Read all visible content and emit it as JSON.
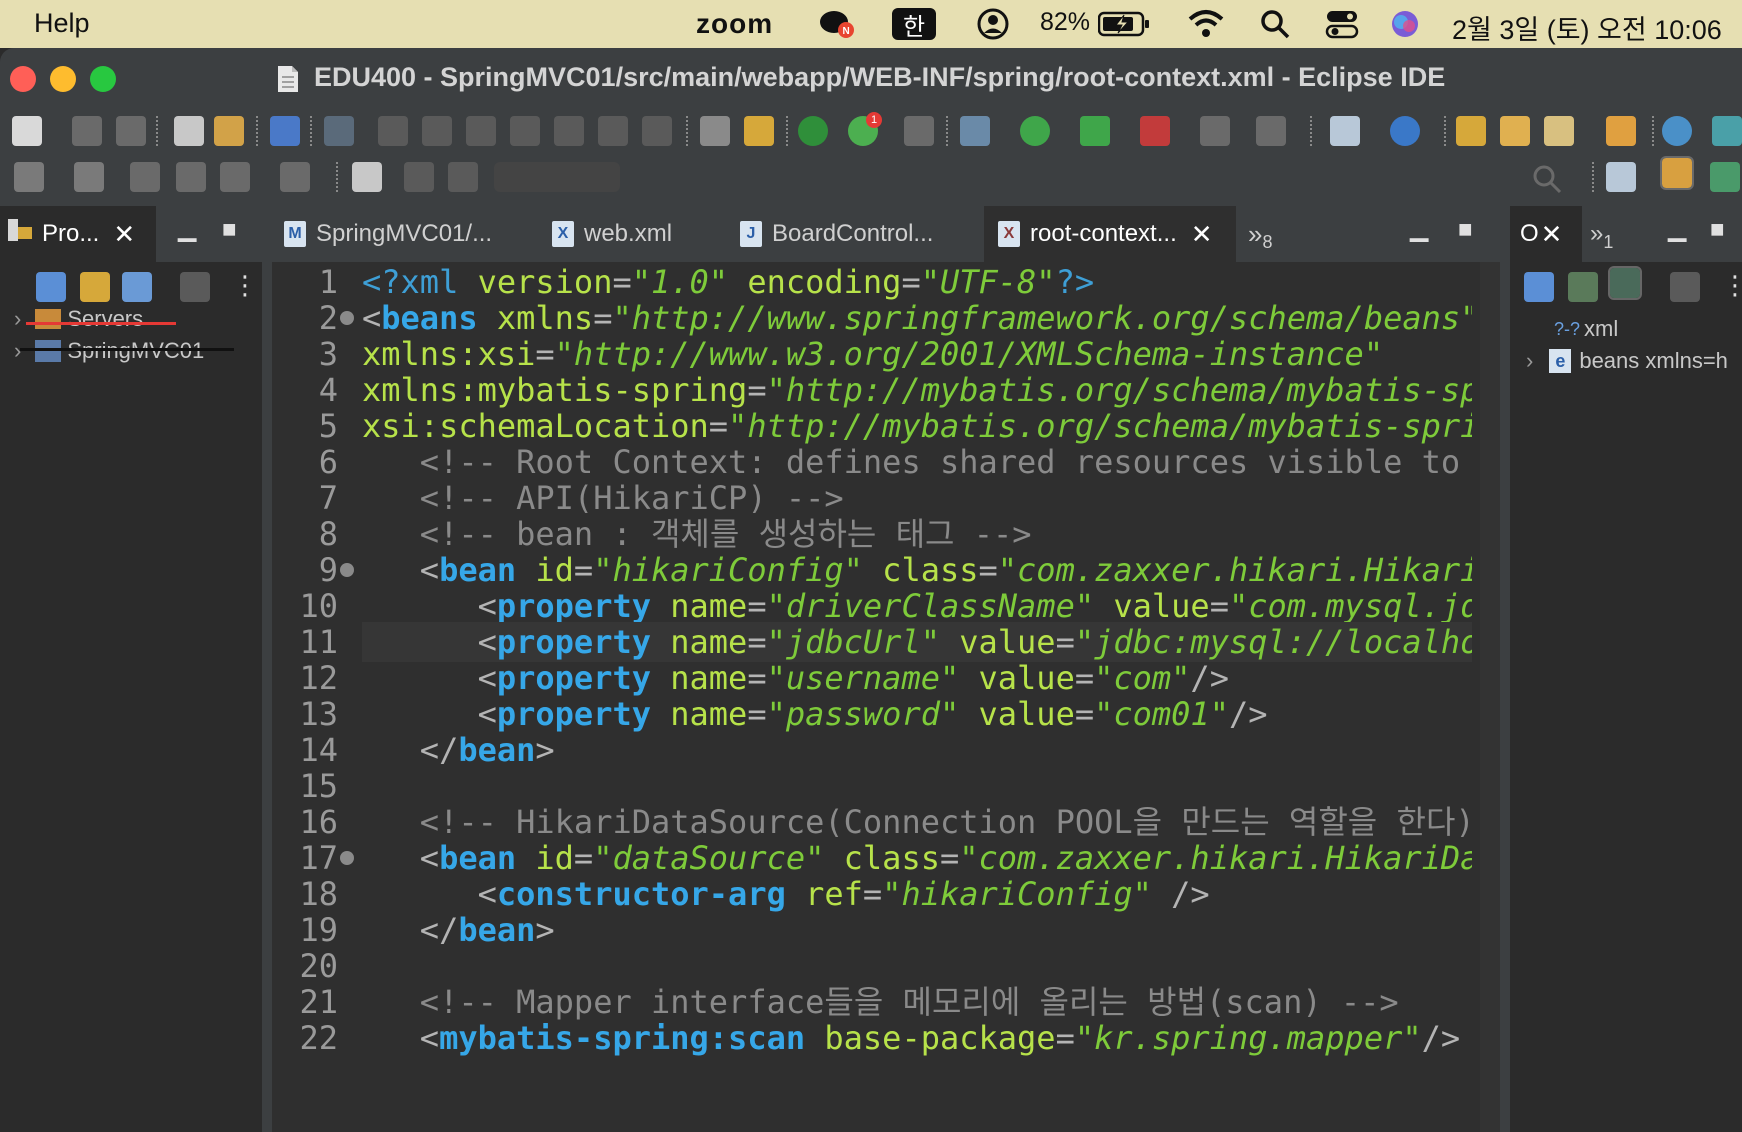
{
  "menubar": {
    "help": "Help",
    "zoom": "zoom",
    "input_method": "한",
    "battery": "82%",
    "datetime": "2월 3일 (토) 오전 10:06",
    "icons": [
      "chat-icon",
      "user-icon",
      "battery-icon",
      "wifi-icon",
      "search-icon",
      "control-center-icon",
      "siri-icon"
    ]
  },
  "window": {
    "title": "EDU400 - SpringMVC01/src/main/webapp/WEB-INF/spring/root-context.xml - Eclipse IDE",
    "colors": {
      "close": "#ff5f57",
      "minimize": "#febc2e",
      "zoom": "#28c840"
    }
  },
  "package_explorer": {
    "tab_label": "Pro...",
    "items": [
      {
        "label": "Servers"
      },
      {
        "label": "SpringMVC01"
      }
    ]
  },
  "editor": {
    "tabs": [
      {
        "label": "SpringMVC01/...",
        "icon": "M"
      },
      {
        "label": "web.xml",
        "icon": "X"
      },
      {
        "label": "BoardControl...",
        "icon": "J"
      },
      {
        "label": "root-context...",
        "icon": "X",
        "active": true
      }
    ],
    "overflow": "»",
    "overflow_count": "8",
    "current_line": 11,
    "lines": [
      {
        "n": "1",
        "fold": false,
        "tokens": [
          [
            "pi",
            "<?xml "
          ],
          [
            "attr",
            "version"
          ],
          [
            "punct",
            "="
          ],
          [
            "val",
            "\"1.0\""
          ],
          [
            "plain",
            " "
          ],
          [
            "attr",
            "encoding"
          ],
          [
            "punct",
            "="
          ],
          [
            "val",
            "\"UTF-8\""
          ],
          [
            "pi",
            "?>"
          ]
        ]
      },
      {
        "n": "2",
        "fold": true,
        "tokens": [
          [
            "punct",
            "<"
          ],
          [
            "tag",
            "beans"
          ],
          [
            "plain",
            " "
          ],
          [
            "attr",
            "xmlns"
          ],
          [
            "punct",
            "="
          ],
          [
            "val",
            "\"http://www.springframework.org/schema/beans\""
          ]
        ]
      },
      {
        "n": "3",
        "fold": false,
        "tokens": [
          [
            "attr",
            "xmlns:xsi"
          ],
          [
            "punct",
            "="
          ],
          [
            "val",
            "\"http://www.w3.org/2001/XMLSchema-instance\""
          ]
        ]
      },
      {
        "n": "4",
        "fold": false,
        "tokens": [
          [
            "attr",
            "xmlns:mybatis-spring"
          ],
          [
            "punct",
            "="
          ],
          [
            "val",
            "\"http://mybatis.org/schema/mybatis-spring\""
          ]
        ]
      },
      {
        "n": "5",
        "fold": false,
        "tokens": [
          [
            "attr",
            "xsi:schemaLocation"
          ],
          [
            "punct",
            "="
          ],
          [
            "val",
            "\"http://mybatis.org/schema/mybatis-spring"
          ]
        ]
      },
      {
        "n": "6",
        "fold": false,
        "tokens": [
          [
            "plain",
            "   "
          ],
          [
            "com",
            "<!-- Root Context: defines shared resources visible to"
          ]
        ]
      },
      {
        "n": "7",
        "fold": false,
        "tokens": [
          [
            "plain",
            "   "
          ],
          [
            "com",
            "<!-- API(HikariCP) -->"
          ]
        ]
      },
      {
        "n": "8",
        "fold": false,
        "tokens": [
          [
            "plain",
            "   "
          ],
          [
            "com",
            "<!-- bean : 객체를 생성하는 태그 -->"
          ]
        ]
      },
      {
        "n": "9",
        "fold": true,
        "tokens": [
          [
            "plain",
            "   "
          ],
          [
            "punct",
            "<"
          ],
          [
            "tag",
            "bean"
          ],
          [
            "plain",
            " "
          ],
          [
            "attr",
            "id"
          ],
          [
            "punct",
            "="
          ],
          [
            "val",
            "\"hikariConfig\""
          ],
          [
            "plain",
            " "
          ],
          [
            "attr",
            "class"
          ],
          [
            "punct",
            "="
          ],
          [
            "val",
            "\"com.zaxxer.hikari.HikariConfig\""
          ]
        ]
      },
      {
        "n": "10",
        "fold": false,
        "tokens": [
          [
            "plain",
            "      "
          ],
          [
            "punct",
            "<"
          ],
          [
            "tag",
            "property"
          ],
          [
            "plain",
            " "
          ],
          [
            "attr",
            "name"
          ],
          [
            "punct",
            "="
          ],
          [
            "val",
            "\"driverClassName\""
          ],
          [
            "plain",
            " "
          ],
          [
            "attr",
            "value"
          ],
          [
            "punct",
            "="
          ],
          [
            "val",
            "\"com.mysql.jdbc"
          ]
        ]
      },
      {
        "n": "11",
        "fold": false,
        "tokens": [
          [
            "plain",
            "      "
          ],
          [
            "punct",
            "<"
          ],
          [
            "tag",
            "property"
          ],
          [
            "plain",
            " "
          ],
          [
            "attr",
            "name"
          ],
          [
            "punct",
            "="
          ],
          [
            "val",
            "\"jdbcUrl\""
          ],
          [
            "plain",
            " "
          ],
          [
            "attr",
            "value"
          ],
          [
            "punct",
            "="
          ],
          [
            "val",
            "\"jdbc:mysql://localhost"
          ]
        ]
      },
      {
        "n": "12",
        "fold": false,
        "tokens": [
          [
            "plain",
            "      "
          ],
          [
            "punct",
            "<"
          ],
          [
            "tag",
            "property"
          ],
          [
            "plain",
            " "
          ],
          [
            "attr",
            "name"
          ],
          [
            "punct",
            "="
          ],
          [
            "val",
            "\"username\""
          ],
          [
            "plain",
            " "
          ],
          [
            "attr",
            "value"
          ],
          [
            "punct",
            "="
          ],
          [
            "val",
            "\"com\""
          ],
          [
            "punct",
            "/>"
          ]
        ]
      },
      {
        "n": "13",
        "fold": false,
        "tokens": [
          [
            "plain",
            "      "
          ],
          [
            "punct",
            "<"
          ],
          [
            "tag",
            "property"
          ],
          [
            "plain",
            " "
          ],
          [
            "attr",
            "name"
          ],
          [
            "punct",
            "="
          ],
          [
            "val",
            "\"password\""
          ],
          [
            "plain",
            " "
          ],
          [
            "attr",
            "value"
          ],
          [
            "punct",
            "="
          ],
          [
            "val",
            "\"com01\""
          ],
          [
            "punct",
            "/>"
          ]
        ]
      },
      {
        "n": "14",
        "fold": false,
        "tokens": [
          [
            "plain",
            "   "
          ],
          [
            "punct",
            "</"
          ],
          [
            "tag",
            "bean"
          ],
          [
            "punct",
            ">"
          ]
        ]
      },
      {
        "n": "15",
        "fold": false,
        "tokens": []
      },
      {
        "n": "16",
        "fold": false,
        "tokens": [
          [
            "plain",
            "   "
          ],
          [
            "com",
            "<!-- HikariDataSource(Connection POOL을 만드는 역할을 한다)"
          ]
        ]
      },
      {
        "n": "17",
        "fold": true,
        "tokens": [
          [
            "plain",
            "   "
          ],
          [
            "punct",
            "<"
          ],
          [
            "tag",
            "bean"
          ],
          [
            "plain",
            " "
          ],
          [
            "attr",
            "id"
          ],
          [
            "punct",
            "="
          ],
          [
            "val",
            "\"dataSource\""
          ],
          [
            "plain",
            " "
          ],
          [
            "attr",
            "class"
          ],
          [
            "punct",
            "="
          ],
          [
            "val",
            "\"com.zaxxer.hikari.HikariDataSource\""
          ]
        ]
      },
      {
        "n": "18",
        "fold": false,
        "tokens": [
          [
            "plain",
            "      "
          ],
          [
            "punct",
            "<"
          ],
          [
            "tag",
            "constructor-arg"
          ],
          [
            "plain",
            " "
          ],
          [
            "attr",
            "ref"
          ],
          [
            "punct",
            "="
          ],
          [
            "val",
            "\"hikariConfig\""
          ],
          [
            "plain",
            " "
          ],
          [
            "punct",
            "/>"
          ]
        ]
      },
      {
        "n": "19",
        "fold": false,
        "tokens": [
          [
            "plain",
            "   "
          ],
          [
            "punct",
            "</"
          ],
          [
            "tag",
            "bean"
          ],
          [
            "punct",
            ">"
          ]
        ]
      },
      {
        "n": "20",
        "fold": false,
        "tokens": []
      },
      {
        "n": "21",
        "fold": false,
        "tokens": [
          [
            "plain",
            "   "
          ],
          [
            "com",
            "<!-- Mapper interface들을 메모리에 올리는 방법(scan) -->"
          ]
        ]
      },
      {
        "n": "22",
        "fold": false,
        "tokens": [
          [
            "plain",
            "   "
          ],
          [
            "punct",
            "<"
          ],
          [
            "tag",
            "mybatis-spring:scan"
          ],
          [
            "plain",
            " "
          ],
          [
            "attr",
            "base-package"
          ],
          [
            "punct",
            "="
          ],
          [
            "val",
            "\"kr.spring.mapper\""
          ],
          [
            "punct",
            "/>"
          ]
        ]
      }
    ]
  },
  "outline": {
    "tab_label": "O",
    "overflow": "»",
    "overflow_count": "1",
    "items": [
      {
        "label": "xml",
        "icon": "?-?"
      },
      {
        "label": "beans xmlns=h",
        "icon": "e"
      }
    ]
  }
}
